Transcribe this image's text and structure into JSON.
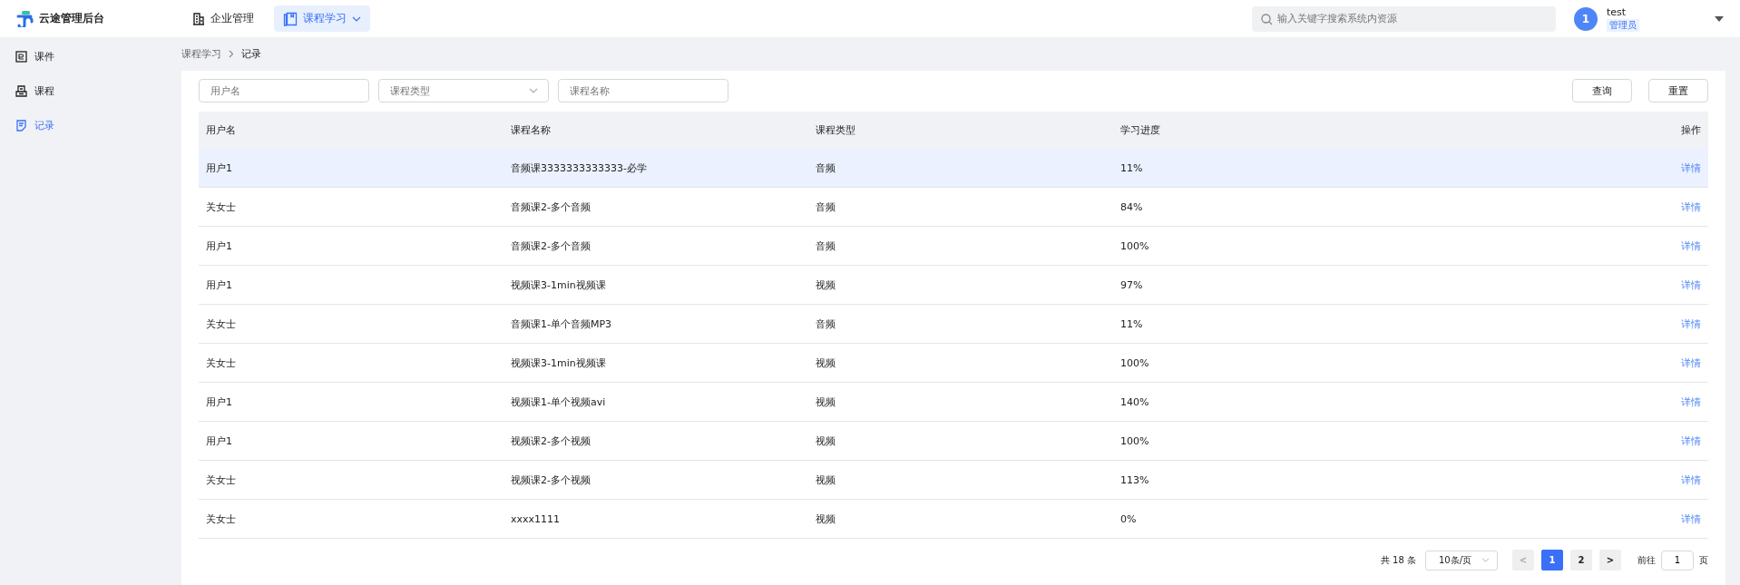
{
  "brand": {
    "name": "云途管理后台"
  },
  "top_nav": [
    {
      "label": "企业管理",
      "selected": false,
      "dropdown": false
    },
    {
      "label": "课程学习",
      "selected": true,
      "dropdown": true
    }
  ],
  "search": {
    "placeholder": "输入关键字搜索系统内资源"
  },
  "user": {
    "avatar": "1",
    "name": "test",
    "role": "管理员"
  },
  "sidebar": {
    "items": [
      {
        "label": "课件",
        "selected": false
      },
      {
        "label": "课程",
        "selected": false
      },
      {
        "label": "记录",
        "selected": true
      }
    ]
  },
  "breadcrumb": [
    "课程学习",
    "记录"
  ],
  "filters": [
    {
      "kind": "text",
      "placeholder": "用户名"
    },
    {
      "kind": "select",
      "placeholder": "课程类型"
    },
    {
      "kind": "text",
      "placeholder": "课程名称"
    }
  ],
  "buttons": [
    "查询",
    "重置"
  ],
  "table": {
    "columns": [
      "用户名",
      "课程名称",
      "课程类型",
      "学习进度",
      "操作"
    ],
    "rows": [
      {
        "cells": [
          "用户1",
          "音频课3333333333333-必学",
          "音频",
          "11%",
          "详情"
        ],
        "selected": true
      },
      {
        "cells": [
          "关女士",
          "音频课2-多个音频",
          "音频",
          "84%",
          "详情"
        ],
        "selected": false
      },
      {
        "cells": [
          "用户1",
          "音频课2-多个音频",
          "音频",
          "100%",
          "详情"
        ],
        "selected": false
      },
      {
        "cells": [
          "用户1",
          "视频课3-1min视频课",
          "视频",
          "97%",
          "详情"
        ],
        "selected": false
      },
      {
        "cells": [
          "关女士",
          "音频课1-单个音频MP3",
          "音频",
          "11%",
          "详情"
        ],
        "selected": false
      },
      {
        "cells": [
          "关女士",
          "视频课3-1min视频课",
          "视频",
          "100%",
          "详情"
        ],
        "selected": false
      },
      {
        "cells": [
          "用户1",
          "视频课1-单个视频avi",
          "视频",
          "140%",
          "详情"
        ],
        "selected": false
      },
      {
        "cells": [
          "用户1",
          "视频课2-多个视频",
          "视频",
          "100%",
          "详情"
        ],
        "selected": false
      },
      {
        "cells": [
          "关女士",
          "视频课2-多个视频",
          "视频",
          "113%",
          "详情"
        ],
        "selected": false
      },
      {
        "cells": [
          "关女士",
          "xxxx1111",
          "视频",
          "0%",
          "详情"
        ],
        "selected": false
      }
    ]
  },
  "pagination": {
    "total": "共 18 条",
    "page_size": "10条/页",
    "prev": "<",
    "next": ">",
    "pages": [
      {
        "label": "1",
        "selected": true
      },
      {
        "label": "2",
        "selected": false
      }
    ],
    "goto_label": "前往",
    "goto_value": "1",
    "goto_suffix": "页"
  }
}
